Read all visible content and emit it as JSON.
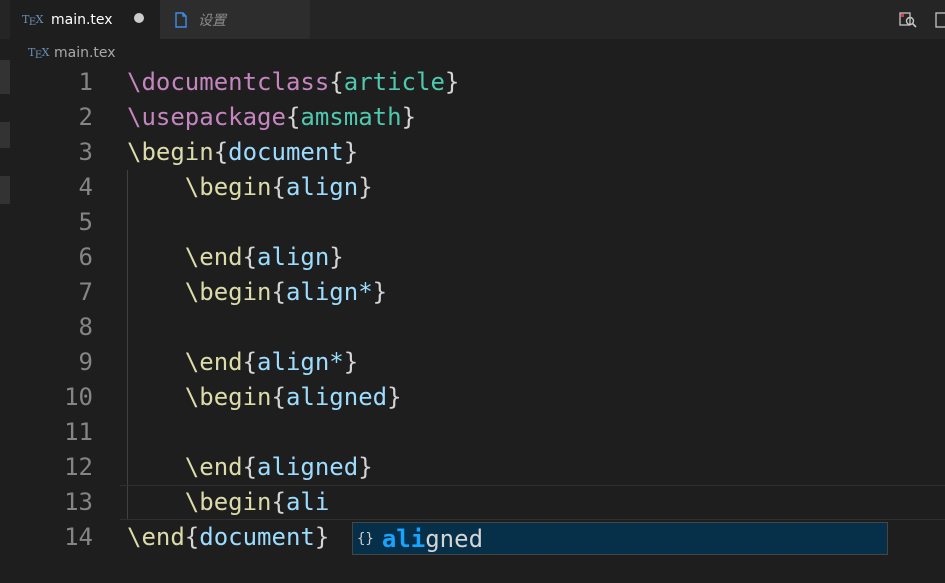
{
  "tabs": [
    {
      "label": "main.tex",
      "icon": "tex-icon",
      "state": "active",
      "unsaved": true
    },
    {
      "label": "设置",
      "icon": "file-icon",
      "state": "inactive"
    }
  ],
  "tex_logo": {
    "t": "T",
    "e": "E",
    "x": "X"
  },
  "breadcrumb": {
    "label": "main.tex"
  },
  "toolbar": {
    "icons": [
      "open-preview-icon",
      "split-editor-icon"
    ]
  },
  "editor": {
    "lines": [
      {
        "num": "1",
        "tokens": [
          {
            "t": "\\documentclass",
            "c": "pink"
          },
          {
            "t": "{",
            "c": "brace"
          },
          {
            "t": "article",
            "c": "green"
          },
          {
            "t": "}",
            "c": "brace"
          }
        ]
      },
      {
        "num": "2",
        "tokens": [
          {
            "t": "\\usepackage",
            "c": "pink"
          },
          {
            "t": "{",
            "c": "brace"
          },
          {
            "t": "amsmath",
            "c": "green"
          },
          {
            "t": "}",
            "c": "brace"
          }
        ]
      },
      {
        "num": "3",
        "tokens": [
          {
            "t": "\\begin",
            "c": "yellow"
          },
          {
            "t": "{",
            "c": "brace"
          },
          {
            "t": "document",
            "c": "blue"
          },
          {
            "t": "}",
            "c": "brace"
          }
        ]
      },
      {
        "num": "4",
        "tokens": [
          {
            "t": "    \\begin",
            "c": "yellow"
          },
          {
            "t": "{",
            "c": "brace"
          },
          {
            "t": "align",
            "c": "blue"
          },
          {
            "t": "}",
            "c": "brace"
          }
        ]
      },
      {
        "num": "5",
        "tokens": []
      },
      {
        "num": "6",
        "tokens": [
          {
            "t": "    \\end",
            "c": "yellow"
          },
          {
            "t": "{",
            "c": "brace"
          },
          {
            "t": "align",
            "c": "blue"
          },
          {
            "t": "}",
            "c": "brace"
          }
        ]
      },
      {
        "num": "7",
        "tokens": [
          {
            "t": "    \\begin",
            "c": "yellow"
          },
          {
            "t": "{",
            "c": "brace"
          },
          {
            "t": "align*",
            "c": "blue"
          },
          {
            "t": "}",
            "c": "brace"
          }
        ]
      },
      {
        "num": "8",
        "tokens": []
      },
      {
        "num": "9",
        "tokens": [
          {
            "t": "    \\end",
            "c": "yellow"
          },
          {
            "t": "{",
            "c": "brace"
          },
          {
            "t": "align*",
            "c": "blue"
          },
          {
            "t": "}",
            "c": "brace"
          }
        ]
      },
      {
        "num": "10",
        "tokens": [
          {
            "t": "    \\begin",
            "c": "yellow"
          },
          {
            "t": "{",
            "c": "brace"
          },
          {
            "t": "aligned",
            "c": "blue"
          },
          {
            "t": "}",
            "c": "brace"
          }
        ]
      },
      {
        "num": "11",
        "tokens": []
      },
      {
        "num": "12",
        "tokens": [
          {
            "t": "    \\end",
            "c": "yellow"
          },
          {
            "t": "{",
            "c": "brace"
          },
          {
            "t": "aligned",
            "c": "blue"
          },
          {
            "t": "}",
            "c": "brace"
          }
        ]
      },
      {
        "num": "13",
        "tokens": [
          {
            "t": "    \\begin",
            "c": "yellow"
          },
          {
            "t": "{",
            "c": "brace"
          },
          {
            "t": "ali",
            "c": "blue"
          }
        ]
      },
      {
        "num": "14",
        "tokens": [
          {
            "t": "\\end",
            "c": "yellow"
          },
          {
            "t": "{",
            "c": "brace"
          },
          {
            "t": "document",
            "c": "blue"
          },
          {
            "t": "}",
            "c": "brace"
          }
        ]
      }
    ]
  },
  "suggest": {
    "icon_glyph": "{}",
    "match": "ali",
    "rest": "gned"
  },
  "colors": {
    "background": "#1e1e1e",
    "command_pink": "#c586c0",
    "arg_green": "#4ec9b0",
    "command_yellow": "#dcdcaa",
    "arg_blue": "#9cdcfe",
    "suggest_bg": "#062f4a",
    "suggest_match": "#18a3ff"
  }
}
